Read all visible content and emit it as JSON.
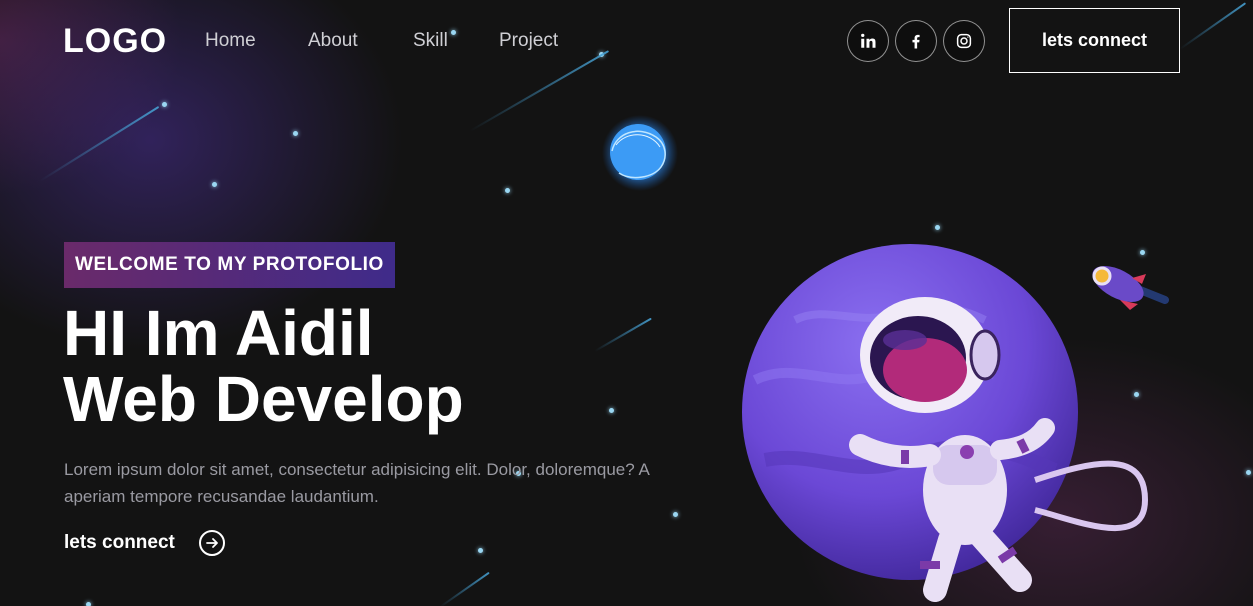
{
  "navbar": {
    "logo": "LOGO",
    "links": [
      {
        "label": "Home"
      },
      {
        "label": "About"
      },
      {
        "label": "Skill"
      },
      {
        "label": "Project"
      }
    ],
    "social": [
      {
        "icon": "linkedin-icon"
      },
      {
        "icon": "facebook-icon"
      },
      {
        "icon": "instagram-icon"
      }
    ],
    "connect_label": "lets connect"
  },
  "hero": {
    "tagline": "WELCOME TO MY PROTOFOLIO",
    "title_line1": "HI Im Aidil",
    "title_line2": "Web Develop",
    "description": "Lorem ipsum dolor sit amet, consectetur adipisicing elit. Dolor, doloremque? A aperiam tempore recusandae laudantium.",
    "cta_label": "lets connect",
    "cta_icon": "arrow-right-circle-icon"
  },
  "colors": {
    "background": "#131313",
    "tagline_gradient_start": "#6a2a6a",
    "tagline_gradient_end": "#3f2b8a",
    "text_primary": "#ffffff",
    "text_muted": "#9a9aa2",
    "accent_star": "#9ad7f2"
  }
}
